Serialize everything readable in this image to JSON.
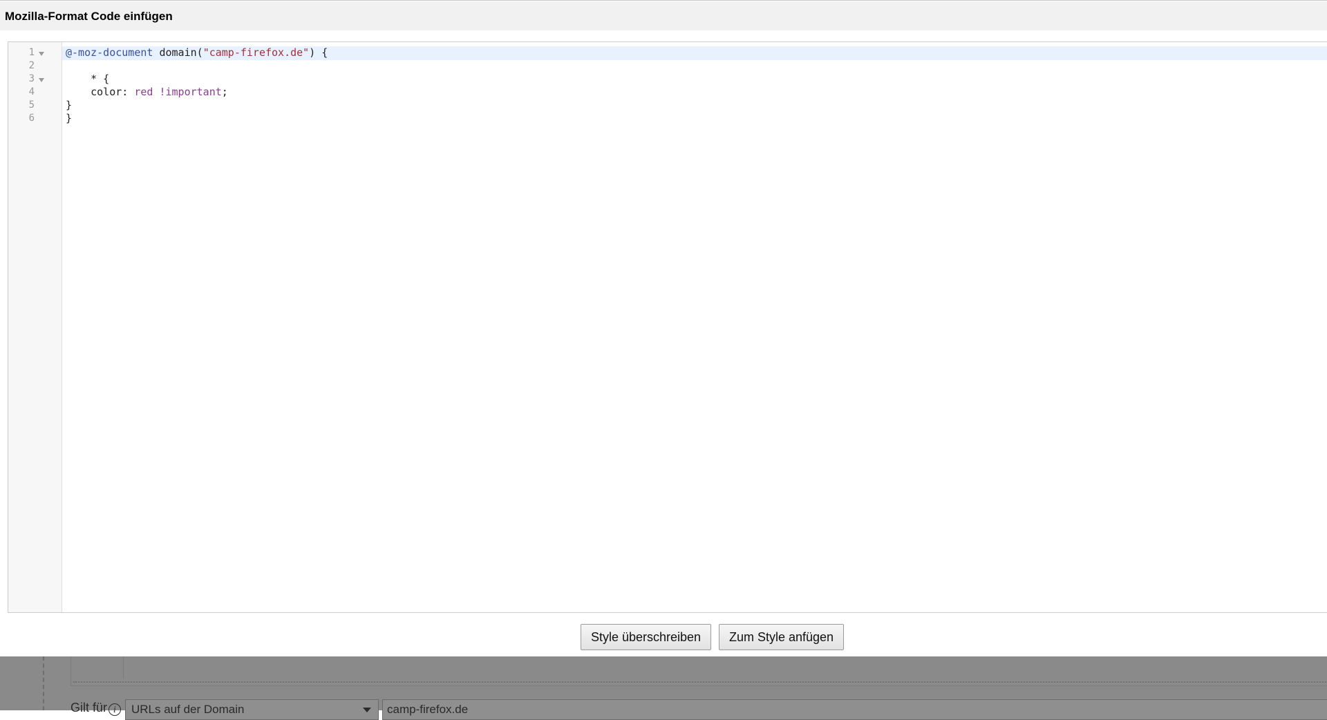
{
  "dialog": {
    "title": "Mozilla-Format Code einfügen",
    "code_lines": [
      {
        "num": "1",
        "foldable": true
      },
      {
        "num": "2",
        "foldable": false
      },
      {
        "num": "3",
        "foldable": true
      },
      {
        "num": "4",
        "foldable": false
      },
      {
        "num": "5",
        "foldable": false
      },
      {
        "num": "6",
        "foldable": false
      }
    ],
    "code": {
      "line1": {
        "at_rule": "@-moz-document",
        "func": " domain(",
        "string": "\"camp-firefox.de\"",
        "tail": ") {"
      },
      "line2": "",
      "line3": "    * {",
      "line4": {
        "prop": "    color: ",
        "value": "red !important",
        "tail": ";"
      },
      "line5": "}",
      "line6": "}"
    },
    "buttons": {
      "overwrite": "Style überschreiben",
      "append": "Zum Style anfügen"
    }
  },
  "background": {
    "applies_label": "Gilt für",
    "info_icon": "i",
    "applies_select": "URLs auf der Domain",
    "applies_value": "camp-firefox.de"
  },
  "colors": {
    "at_rule": "#3a4fa0",
    "string": "#a3303c",
    "keyword": "#8b3c92",
    "active_line": "#e8f2ff",
    "overlay": "#8a8a8a"
  }
}
